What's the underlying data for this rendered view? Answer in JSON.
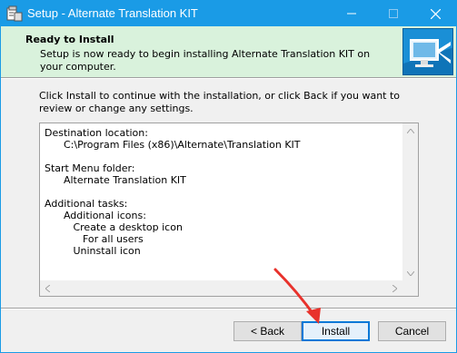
{
  "window": {
    "title": "Setup - Alternate Translation KIT",
    "controls": {
      "minimize": "minimize-icon",
      "maximize": "maximize-icon",
      "close": "close-icon"
    }
  },
  "header": {
    "title": "Ready to Install",
    "description": "Setup is now ready to begin installing Alternate Translation KIT on your computer."
  },
  "instructions": "Click Install to continue with the installation, or click Back if you want to review or change any settings.",
  "summary": {
    "lines": [
      "Destination location:",
      "      C:\\Program Files (x86)\\Alternate\\Translation KIT",
      "",
      "Start Menu folder:",
      "      Alternate Translation KIT",
      "",
      "Additional tasks:",
      "      Additional icons:",
      "         Create a desktop icon",
      "            For all users",
      "         Uninstall icon"
    ]
  },
  "buttons": {
    "back": "< Back",
    "install": "Install",
    "cancel": "Cancel"
  },
  "colors": {
    "titlebar": "#1a9be6",
    "header_bg": "#d9f2dc",
    "annotation_arrow": "#e8322c"
  }
}
